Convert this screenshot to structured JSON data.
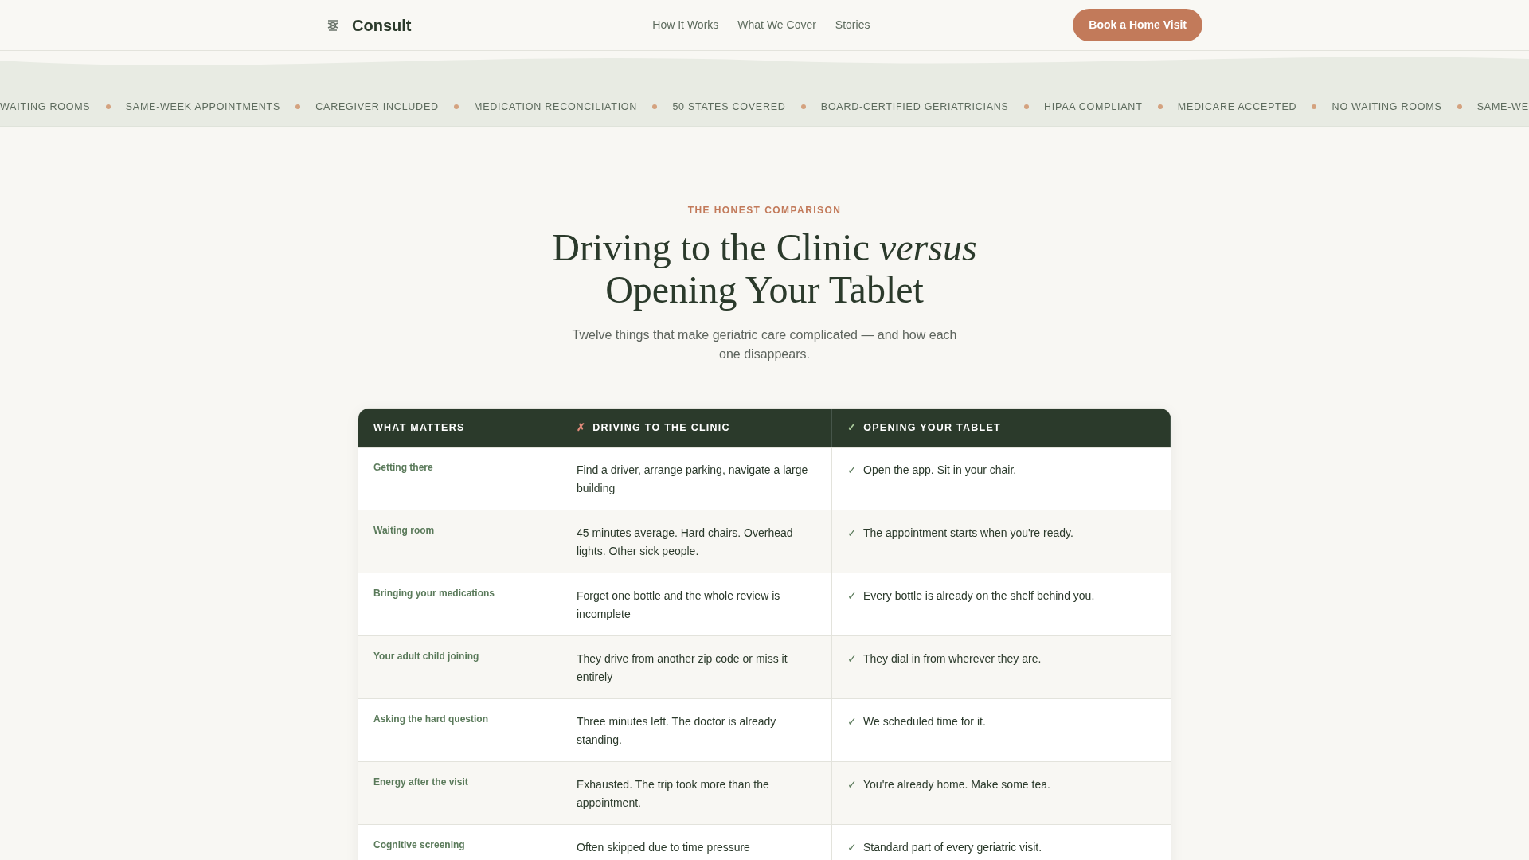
{
  "nav": {
    "brand": "Consult",
    "links": [
      "How It Works",
      "What We Cover",
      "Stories"
    ],
    "cta": "Book a Home Visit"
  },
  "ticker": [
    "WAITING ROOMS",
    "SAME-WEEK APPOINTMENTS",
    "CAREGIVER INCLUDED",
    "MEDICATION RECONCILIATION",
    "50 STATES COVERED",
    "BOARD-CERTIFIED GERIATRICIANS",
    "HIPAA COMPLIANT",
    "MEDICARE ACCEPTED",
    "NO WAITING ROOMS",
    "SAME-WE"
  ],
  "section": {
    "eyebrow": "THE HONEST COMPARISON",
    "title": "Driving to the Clinic *versus* Opening Your Tablet",
    "subtitle": "Twelve things that make geriatric care complicated — and how each one disappears."
  },
  "table": {
    "columns": [
      {
        "label": "WHAT MATTERS"
      },
      {
        "mark": "✗",
        "label": "DRIVING TO THE CLINIC"
      },
      {
        "mark": "✓",
        "label": "OPENING YOUR TABLET"
      }
    ],
    "rows": [
      {
        "label": "Getting there",
        "clinic": "Find a driver, arrange parking, navigate a large building",
        "mark": "✓",
        "tablet": "Open the app. Sit in your chair."
      },
      {
        "label": "Waiting room",
        "clinic": "45 minutes average. Hard chairs. Overhead lights. Other sick people.",
        "mark": "✓",
        "tablet": "The appointment starts when you're ready."
      },
      {
        "label": "Bringing your medications",
        "clinic": "Forget one bottle and the whole review is incomplete",
        "mark": "✓",
        "tablet": "Every bottle is already on the shelf behind you."
      },
      {
        "label": "Your adult child joining",
        "clinic": "They drive from another zip code or miss it entirely",
        "mark": "✓",
        "tablet": "They dial in from wherever they are."
      },
      {
        "label": "Asking the hard question",
        "clinic": "Three minutes left. The doctor is already standing.",
        "mark": "✓",
        "tablet": "We scheduled time for it."
      },
      {
        "label": "Energy after the visit",
        "clinic": "Exhausted. The trip took more than the appointment.",
        "mark": "✓",
        "tablet": "You're already home. Make some tea."
      },
      {
        "label": "Cognitive screening",
        "clinic": "Often skipped due to time pressure",
        "mark": "✓",
        "tablet": "Standard part of every geriatric visit."
      }
    ]
  }
}
